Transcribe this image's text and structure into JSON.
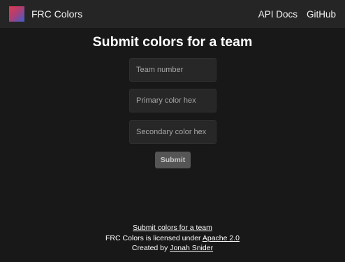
{
  "navbar": {
    "brand": "FRC Colors",
    "links": [
      {
        "label": "API Docs"
      },
      {
        "label": "GitHub"
      }
    ]
  },
  "page": {
    "title": "Submit colors for a team"
  },
  "form": {
    "team_number": {
      "value": "",
      "placeholder": "Team number"
    },
    "primary_color": {
      "value": "",
      "placeholder": "Primary color hex"
    },
    "secondary_color": {
      "value": "",
      "placeholder": "Secondary color hex"
    },
    "submit_label": "Submit"
  },
  "footer": {
    "submit_link": "Submit colors for a team",
    "license_prefix": "FRC Colors is licensed under ",
    "license_link": "Apache 2.0",
    "created_prefix": "Created by ",
    "author_link": "Jonah Snider"
  },
  "colors": {
    "background": "#181818",
    "navbar": "#252525",
    "input": "#272727",
    "button": "#555555",
    "logo_gradient": [
      "#e0394a",
      "#3a5fd0"
    ]
  }
}
